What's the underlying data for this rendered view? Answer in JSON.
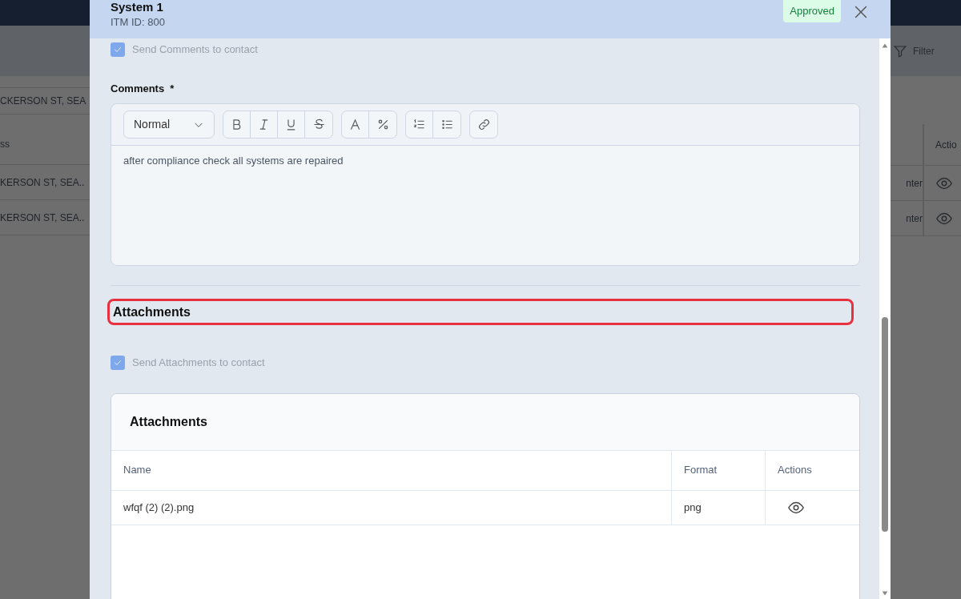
{
  "background": {
    "left": {
      "address_field": "CKERSON ST, SEA",
      "column_header": "ss",
      "rows": [
        "KERSON ST, SEA..",
        "KERSON ST, SEA.."
      ]
    },
    "right": {
      "filter_button": "Filter",
      "column_header": "Actio",
      "rows": [
        "nter",
        "nter"
      ]
    }
  },
  "modal": {
    "title": "System 1",
    "item_id": "ITM ID: 800",
    "status": "Approved",
    "send_comments": {
      "label": "Send Comments to contact",
      "checked": true
    },
    "comments": {
      "label": "Comments",
      "required_mark": "*",
      "format": "Normal",
      "value": "after compliance check all systems are repaired"
    },
    "section": {
      "heading": "Attachments",
      "highlighted": true
    },
    "send_attachments": {
      "label": "Send Attachments to contact",
      "checked": true
    },
    "attachments": {
      "title": "Attachments",
      "columns": [
        "Name",
        "Format",
        "Actions"
      ],
      "rows": [
        {
          "name": "wfqf (2) (2).png",
          "format": "png"
        }
      ]
    }
  }
}
